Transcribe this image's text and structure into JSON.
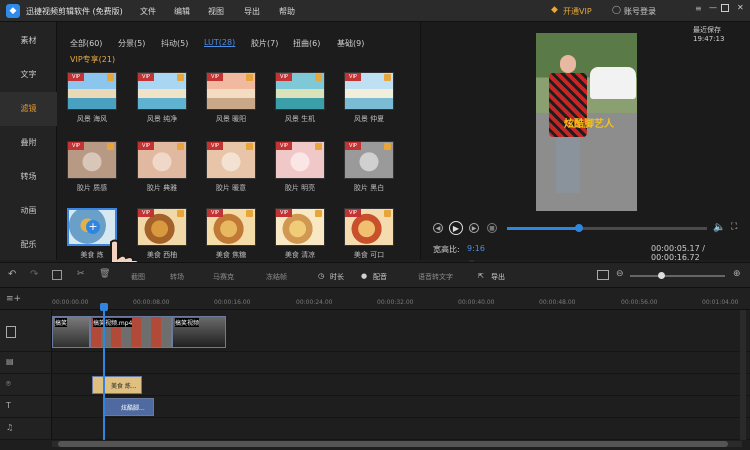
{
  "app": {
    "title": "迅捷视频剪辑软件 (免费版)"
  },
  "menu": [
    "文件",
    "编辑",
    "视图",
    "导出",
    "帮助"
  ],
  "account": {
    "vip": "开通VIP",
    "login": "账号登录",
    "autosave": "最近保存 19:47:13"
  },
  "sidebar": [
    "素材",
    "文字",
    "滤镜",
    "叠附",
    "转场",
    "动画",
    "配乐"
  ],
  "categories": [
    "全部(60)",
    "分景(5)",
    "抖动(5)",
    "LUT(28)",
    "胶片(7)",
    "扭曲(6)",
    "基础(9)"
  ],
  "vip_label": "VIP专享(21)",
  "filters": [
    [
      "风景 海风",
      "风景 纯净",
      "风景 暖阳",
      "风景 生机",
      "风景 仲夏"
    ],
    [
      "胶片 质感",
      "胶片 典雅",
      "胶片 暖意",
      "胶片 明亮",
      "胶片 黑白"
    ],
    [
      "美食 炼",
      "美食 西柚",
      "美食 焦糖",
      "美食 清凉",
      "美食 可口"
    ]
  ],
  "player": {
    "overlay_text": "炫酷脚艺人",
    "ratio_label": "宽高比:",
    "ratio_value": "9:16",
    "time": "00:00:05.17 / 00:00:16.72",
    "progress": 0.36
  },
  "toolbar": [
    "截图",
    "转场",
    "马赛克",
    "冻结帧",
    "时长",
    "配音",
    "语音转文字",
    "导出"
  ],
  "timeline": {
    "ticks": [
      "00:00:00.00",
      "00:00:08.00",
      "00:00:16.00",
      "00:00:24.00",
      "00:00:32.00",
      "00:00:40.00",
      "00:00:48.00",
      "00:00:56.00",
      "00:01:04.00"
    ],
    "clips": [
      "搞笑",
      "搞笑视频.mp4",
      "搞笑视频"
    ],
    "filter_clip": "美食 炼...",
    "text_clip": "炫酷脚..."
  }
}
